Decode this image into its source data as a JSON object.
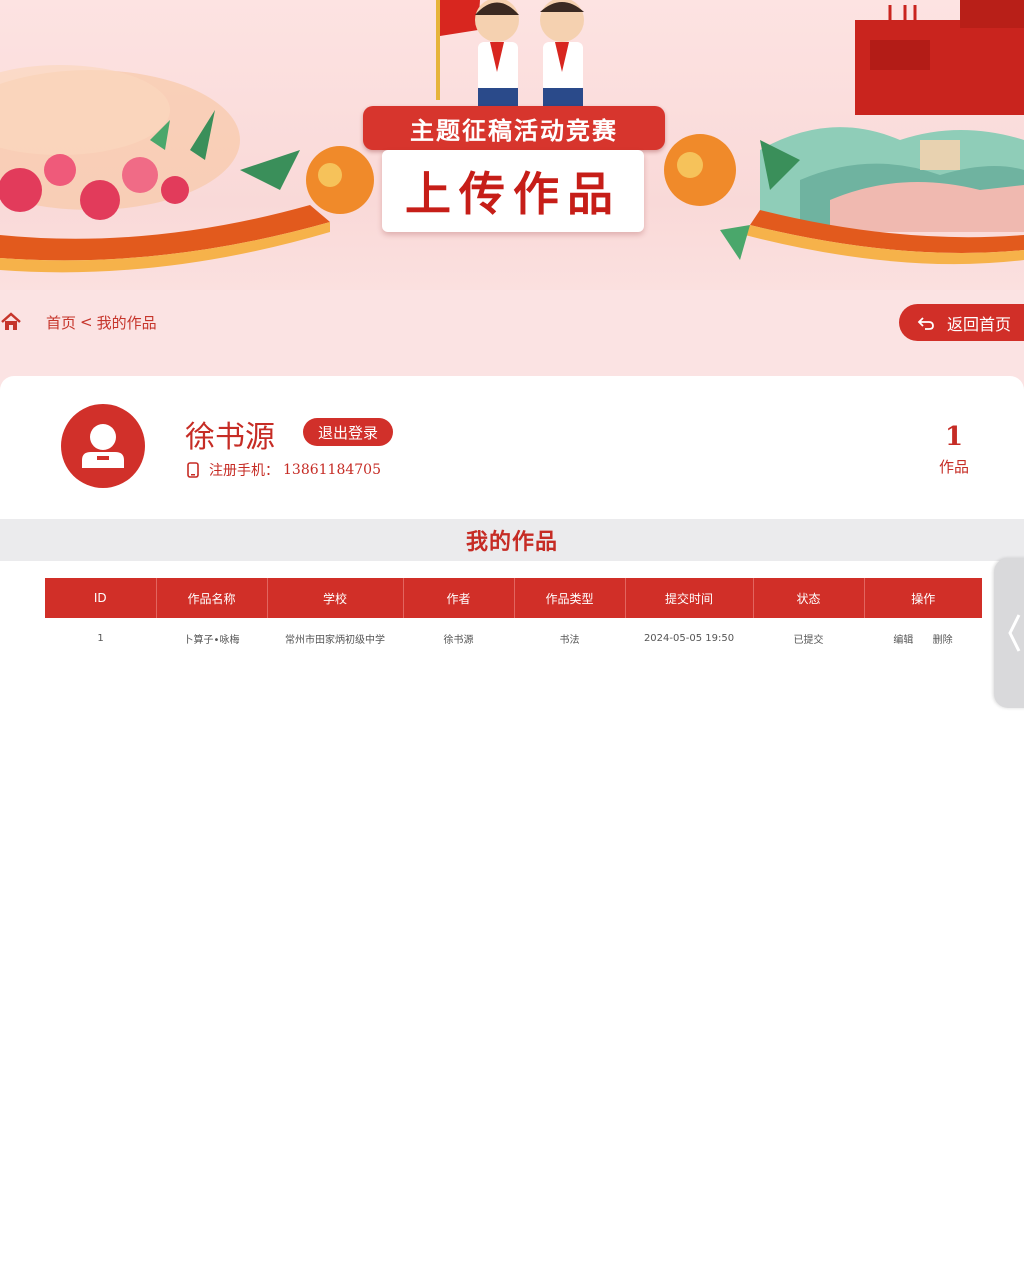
{
  "banner": {
    "subtitle": "主题征稿活动竞赛",
    "title": "上传作品"
  },
  "breadcrumb": {
    "home": "首页",
    "separator": "<",
    "current": "我的作品"
  },
  "back_button": {
    "label": "返回首页"
  },
  "user": {
    "name": "徐书源",
    "logout_label": "退出登录",
    "phone_label": "注册手机：",
    "phone": "13861184705",
    "works_count": "1",
    "works_label": "作品"
  },
  "section": {
    "title": "我的作品"
  },
  "table": {
    "headers": [
      "ID",
      "作品名称",
      "学校",
      "作者",
      "作品类型",
      "提交时间",
      "状态",
      "操作"
    ],
    "rows": [
      {
        "id": "1",
        "name": "卜算子•咏梅",
        "school": "常州市田家炳初级中学",
        "author": "徐书源",
        "type": "书法",
        "time": "2024-05-05 19:50",
        "status": "已提交",
        "edit": "编辑",
        "delete": "删除"
      }
    ]
  },
  "colors": {
    "primary": "#d1302a",
    "text_red": "#c62c25",
    "page_bg": "#fbe3e3",
    "section_bg": "#ebebed"
  },
  "icons": [
    "home-icon",
    "back-arrow-icon",
    "user-avatar-icon",
    "phone-icon",
    "chevron-left-icon"
  ]
}
